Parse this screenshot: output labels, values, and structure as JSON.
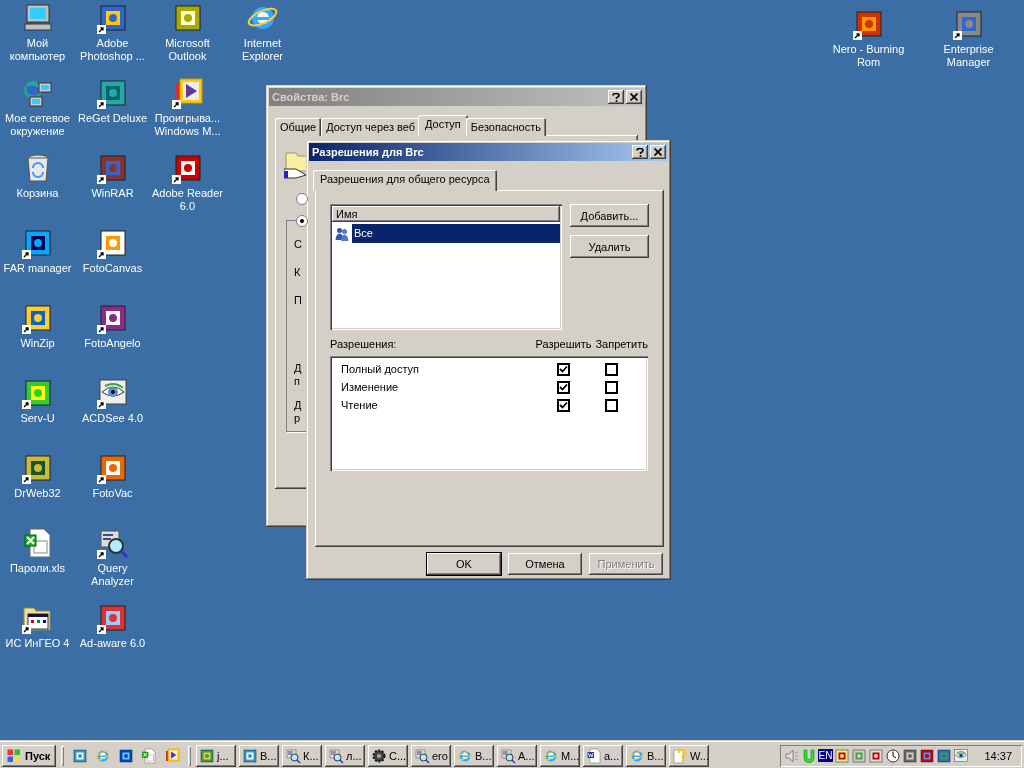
{
  "desktop": {
    "icon_columns": [
      [
        {
          "label": "Мой компьютер",
          "shortcut": false
        },
        {
          "label": "Мое сетевое окружение",
          "shortcut": false
        },
        {
          "label": "Корзина",
          "shortcut": false
        },
        {
          "label": "FAR manager",
          "shortcut": true
        },
        {
          "label": "WinZip",
          "shortcut": true
        },
        {
          "label": "Serv-U",
          "shortcut": true
        },
        {
          "label": "DrWeb32",
          "shortcut": true
        },
        {
          "label": "Пароли.xls",
          "shortcut": false
        },
        {
          "label": "ИС ИнГЕО 4",
          "shortcut": true
        }
      ],
      [
        {
          "label": "Adobe Photoshop ...",
          "shortcut": true
        },
        {
          "label": "ReGet Deluxe",
          "shortcut": true
        },
        {
          "label": "WinRAR",
          "shortcut": true
        },
        {
          "label": "FotoCanvas",
          "shortcut": true
        },
        {
          "label": "FotoAngelo",
          "shortcut": true
        },
        {
          "label": "ACDSee 4.0",
          "shortcut": true
        },
        {
          "label": "FotoVac",
          "shortcut": true
        },
        {
          "label": "Query Analyzer",
          "shortcut": true
        },
        {
          "label": "Ad-aware 6.0",
          "shortcut": true
        }
      ],
      [
        {
          "label": "Microsoft Outlook",
          "shortcut": false
        },
        {
          "label": "Проигрыва... Windows M...",
          "shortcut": true
        },
        {
          "label": "Adobe Reader 6.0",
          "shortcut": true
        }
      ],
      [
        {
          "label": "Internet Explorer",
          "shortcut": false
        }
      ]
    ],
    "right_icons": [
      {
        "label": "Nero - Burning Rom",
        "shortcut": true
      },
      {
        "label": "Enterprise Manager",
        "shortcut": true
      }
    ]
  },
  "properties_window": {
    "title": "Свойства: Brc",
    "active": false,
    "tabs": [
      {
        "label": "Общие",
        "selected": false
      },
      {
        "label": "Доступ через веб",
        "selected": false
      },
      {
        "label": "Доступ",
        "selected": true
      },
      {
        "label": "Безопасность",
        "selected": false
      }
    ],
    "radios": [
      {
        "selected": false
      },
      {
        "selected": true
      }
    ],
    "group_lines": [
      {
        "lines": [
          "С"
        ]
      },
      {
        "lines": [
          "К"
        ]
      },
      {
        "lines": [
          "П"
        ]
      },
      {
        "lines": [
          "Д",
          "п"
        ]
      },
      {
        "lines": [
          "Д",
          "р"
        ]
      }
    ]
  },
  "permissions_dialog": {
    "title": "Разрешения для Brc",
    "active": true,
    "tabs": [
      {
        "label": "Разрешения для общего ресурса",
        "selected": true
      }
    ],
    "list_header": "Имя",
    "list_items": [
      {
        "name": "Все",
        "selected": true
      }
    ],
    "side_buttons": [
      {
        "label": "Добавить..."
      },
      {
        "label": "Удалить"
      }
    ],
    "permissions_label": "Разрешения:",
    "allow_header": "Разрешить",
    "deny_header": "Запретить",
    "permissions": [
      {
        "name": "Полный доступ",
        "allow": true,
        "deny": false
      },
      {
        "name": "Изменение",
        "allow": true,
        "deny": false
      },
      {
        "name": "Чтение",
        "allow": true,
        "deny": false
      }
    ],
    "buttons": [
      {
        "label": "OK",
        "default": true,
        "disabled": false
      },
      {
        "label": "Отмена",
        "default": false,
        "disabled": false
      },
      {
        "label": "Применить",
        "default": false,
        "disabled": true
      }
    ]
  },
  "taskbar": {
    "start_label": "Пуск",
    "tasks": [
      {
        "label": "j..."
      },
      {
        "label": "В..."
      },
      {
        "label": "К..."
      },
      {
        "label": "л..."
      },
      {
        "label": "С..."
      },
      {
        "label": "ero"
      },
      {
        "label": "В..."
      },
      {
        "label": "А..."
      },
      {
        "label": "М..."
      },
      {
        "label": "a..."
      },
      {
        "label": "В..."
      },
      {
        "label": "W..."
      }
    ],
    "tray": {
      "language": "EN",
      "time": "14:37"
    }
  }
}
